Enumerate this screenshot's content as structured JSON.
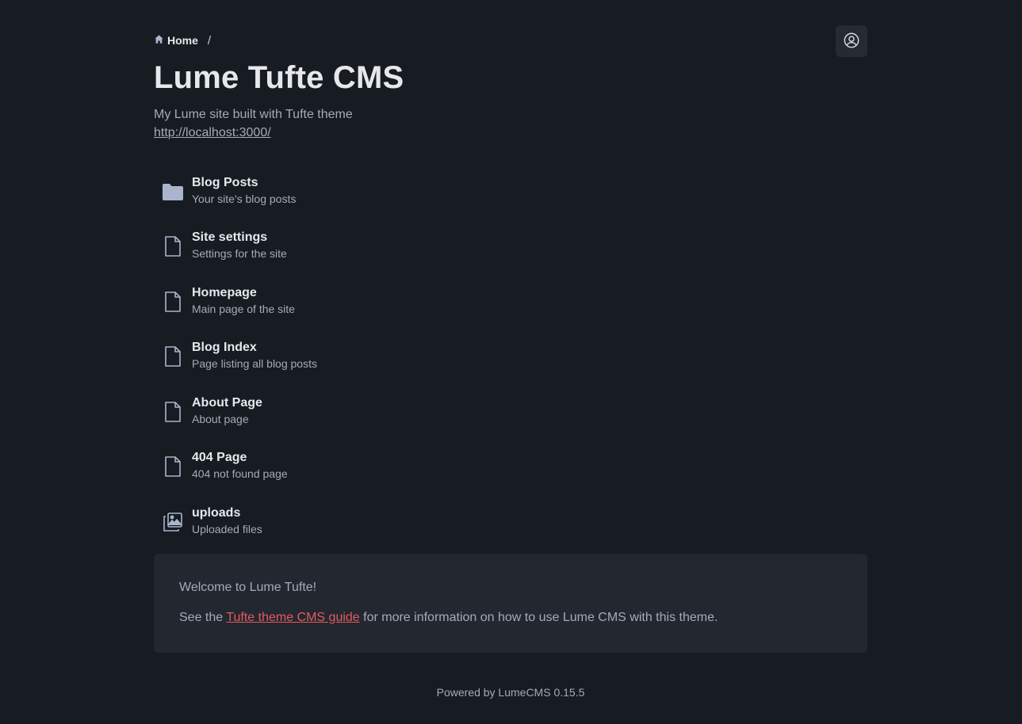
{
  "breadcrumb": {
    "home_label": "Home",
    "separator": "/"
  },
  "site": {
    "title": "Lume Tufte CMS",
    "description": "My Lume site built with Tufte theme",
    "url": "http://localhost:3000/"
  },
  "collections": [
    {
      "label": "Blog Posts",
      "description": "Your site's blog posts",
      "icon": "folder-icon"
    },
    {
      "label": "Site settings",
      "description": "Settings for the site",
      "icon": "file-icon"
    },
    {
      "label": "Homepage",
      "description": "Main page of the site",
      "icon": "file-icon"
    },
    {
      "label": "Blog Index",
      "description": "Page listing all blog posts",
      "icon": "file-icon"
    },
    {
      "label": "About Page",
      "description": "About page",
      "icon": "file-icon"
    },
    {
      "label": "404 Page",
      "description": "404 not found page",
      "icon": "file-icon"
    },
    {
      "label": "uploads",
      "description": "Uploaded files",
      "icon": "images-icon"
    }
  ],
  "welcome": {
    "line1": "Welcome to Lume Tufte!",
    "line2_before": "See the ",
    "line2_link": "Tufte theme CMS guide",
    "line2_after": " for more information on how to use Lume CMS with this theme."
  },
  "footer": {
    "text": "Powered by LumeCMS 0.15.5"
  },
  "colors": {
    "background": "#171b22",
    "panel": "#232730",
    "accent_link": "#e45a5f",
    "icon": "#aab4cc"
  }
}
